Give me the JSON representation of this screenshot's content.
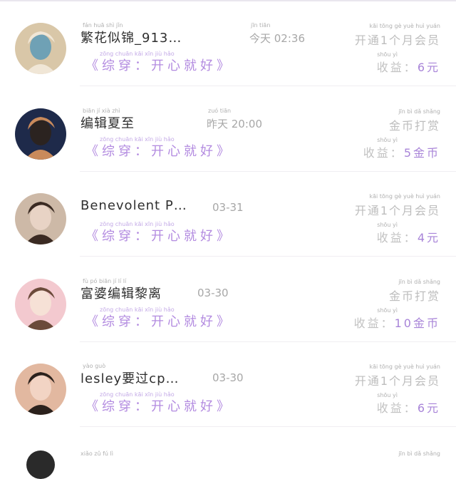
{
  "items": [
    {
      "name": "繁花似锦_913…",
      "name_pinyin": "fán  huā  shì  jǐn",
      "time": "今天 02:36",
      "time_pinyin": "jīn tiān",
      "work": "《综穿：开心就好》",
      "work_pinyin": "zōng chuān      kāi  xīn  jiù  hǎo",
      "status": "开通1个月会员",
      "status_pinyin": "kāi tōng  gè  yuè huì yuán",
      "earn_label": "收益：",
      "earn_pinyin": "shōu  yì",
      "earn_value": "6元",
      "avatar_colors": [
        "#d9c7a8",
        "#f0e6d6",
        "#6fa1b5"
      ]
    },
    {
      "name": "编辑夏至",
      "name_pinyin": "biān  jí  xià  zhì",
      "time": "昨天 20:00",
      "time_pinyin": "zuó  tiān",
      "work": "《综穿：开心就好》",
      "work_pinyin": "zōng chuān      kāi  xīn  jiù  hǎo",
      "status": "金币打赏",
      "status_pinyin": "jīn   bì   dǎ  shǎng",
      "earn_label": "收益：",
      "earn_pinyin": "shōu  yì",
      "earn_value": "5金币",
      "avatar_colors": [
        "#1e2a4a",
        "#c98a5b",
        "#2b2320"
      ]
    },
    {
      "name": "Benevolent P…",
      "name_pinyin": "",
      "time": "03-31",
      "time_pinyin": "",
      "work": "《综穿：开心就好》",
      "work_pinyin": "zōng chuān      kāi  xīn  jiù  hǎo",
      "status": "开通1个月会员",
      "status_pinyin": "kāi tōng  gè  yuè huì yuán",
      "earn_label": "收益：",
      "earn_pinyin": "shōu  yì",
      "earn_value": "4元",
      "avatar_colors": [
        "#cdb9a7",
        "#3a2a22",
        "#e8d3c5"
      ]
    },
    {
      "name": "富婆编辑黎离",
      "name_pinyin": "fù  pó  biān  jí  lí   lí",
      "time": "03-30",
      "time_pinyin": "",
      "work": "《综穿：开心就好》",
      "work_pinyin": "zōng chuān      kāi  xīn  jiù  hǎo",
      "status": "金币打赏",
      "status_pinyin": "jīn   bì   dǎ  shǎng",
      "earn_label": "收益：",
      "earn_pinyin": "shōu  yì",
      "earn_value": "10金币",
      "avatar_colors": [
        "#f3c9cf",
        "#6b4a3a",
        "#f6e1d6"
      ]
    },
    {
      "name": "lesley要过cp…",
      "name_pinyin": "yào  guò",
      "time": "03-30",
      "time_pinyin": "",
      "work": "《综穿：开心就好》",
      "work_pinyin": "zōng chuān      kāi  xīn  jiù  hǎo",
      "status": "开通1个月会员",
      "status_pinyin": "kāi tōng  gè  yuè huì yuán",
      "earn_label": "收益：",
      "earn_pinyin": "shōu  yì",
      "earn_value": "6元",
      "avatar_colors": [
        "#e2b8a0",
        "#2b211c",
        "#f2d4c4"
      ]
    }
  ],
  "peek": {
    "name_pinyin": "xiǎo  zǔ   fú   lì",
    "status_pinyin": "jīn   bì   dǎ  shǎng"
  }
}
